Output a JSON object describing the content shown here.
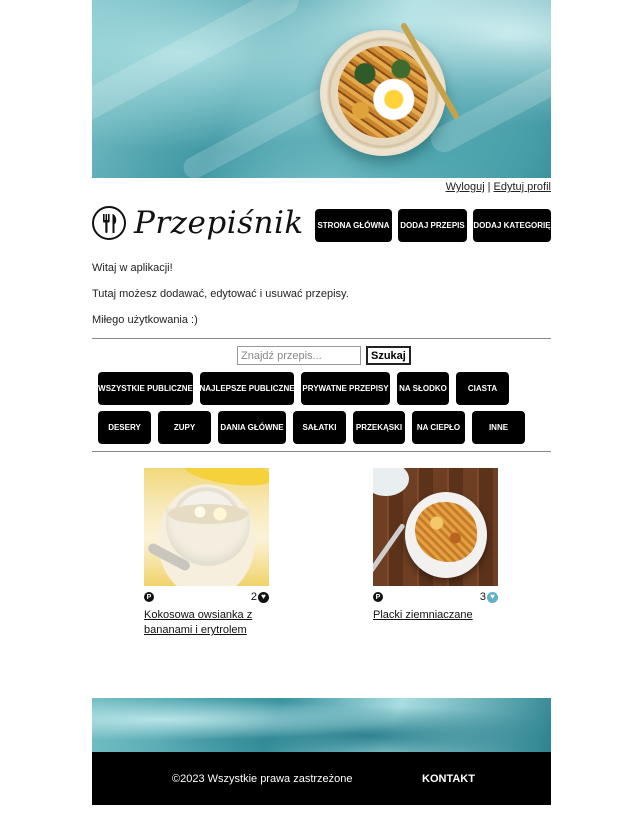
{
  "header": {
    "logout": "Wyloguj",
    "separator": "|",
    "edit_profile": "Edytuj profil",
    "app_name": "Przepiśnik"
  },
  "nav": [
    {
      "label": "STRONA GŁÓWNA"
    },
    {
      "label": "DODAJ PRZEPIS"
    },
    {
      "label": "DODAJ KATEGORIĘ"
    }
  ],
  "intro": {
    "line1": "Witaj w aplikacji!",
    "line2": "Tutaj możesz dodawać, edytować i usuwać przepisy.",
    "line3": "Miłego użytkowania :)"
  },
  "search": {
    "placeholder": "Znajdź przepis...",
    "button": "Szukaj"
  },
  "categories_row1": [
    {
      "label": "WSZYSTKIE PUBLICZNE"
    },
    {
      "label": "NAJLEPSZE PUBLICZNE"
    },
    {
      "label": "PRYWATNE PRZEPISY"
    },
    {
      "label": "NA SŁODKO"
    },
    {
      "label": "CIASTA"
    }
  ],
  "categories_row2": [
    {
      "label": "DESERY"
    },
    {
      "label": "ZUPY"
    },
    {
      "label": "DANIA GŁÓWNE"
    },
    {
      "label": "SAŁATKI"
    },
    {
      "label": "PRZEKĄSKI"
    },
    {
      "label": "NA CIEPŁO"
    },
    {
      "label": "INNE"
    }
  ],
  "recipes": [
    {
      "badge": "P",
      "likes": "2",
      "heart_color": "#111111",
      "title": "Kokosowa owsianka z bananami i erytrolem"
    },
    {
      "badge": "P",
      "likes": "3",
      "heart_color": "#5fb0c8",
      "title": "Placki ziemniaczane"
    }
  ],
  "footer": {
    "copyright": "©2023 Wszystkie prawa zastrzeżone",
    "contact": "KONTAKT"
  }
}
